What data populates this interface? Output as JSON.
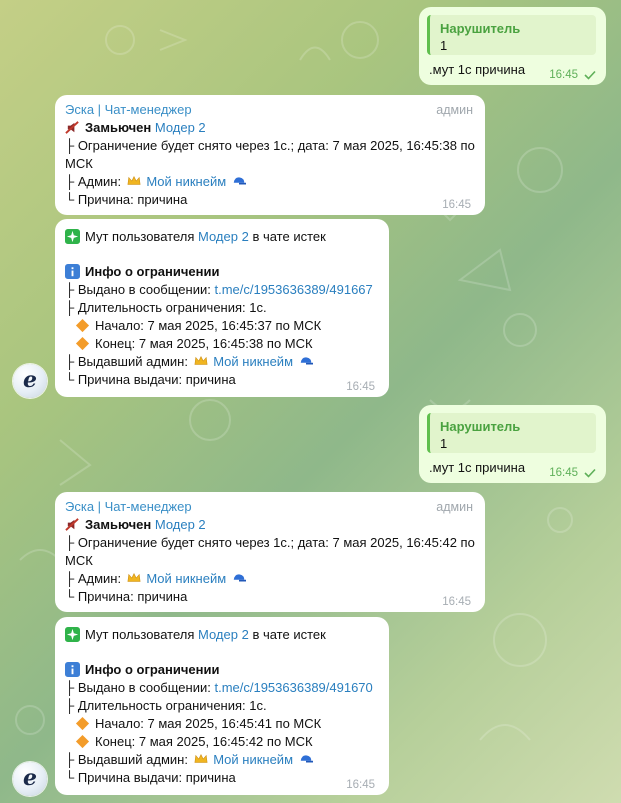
{
  "self": {
    "quote_name": "Нарушитель",
    "quote_text": "1",
    "text": ".мут 1с причина",
    "time": "16:45"
  },
  "bot": {
    "name": "Эска | Чат-менеджер",
    "role": "админ",
    "avatar_letter": "e",
    "muted_label": "Замьючен",
    "user": "Модер 2",
    "admin_nick": "Мой никнейм"
  },
  "mute_msgs": [
    {
      "line1": "├ Ограничение будет снято через 1с.; дата: 7 мая 2025, 16:45:38 по",
      "line2": "МСК",
      "admin_label": "├ Админ:",
      "reason": "└ Причина: причина",
      "time": "16:45"
    },
    {
      "line1": "├ Ограничение будет снято через 1с.; дата: 7 мая 2025, 16:45:42 по",
      "line2": "МСК",
      "admin_label": "├ Админ:",
      "reason": "└ Причина: причина",
      "time": "16:45"
    }
  ],
  "expire_msgs": [
    {
      "prefix": "Мут пользователя",
      "suffix": "в чате истек",
      "info_title": "Инфо о ограничении",
      "issued_label": "├ Выдано в сообщении:",
      "link": "t.me/c/1953636389/491667",
      "duration": "├ Длительность ограничения: 1с.",
      "start": "Начало: 7 мая 2025, 16:45:37 по МСК",
      "end": "Конец: 7 мая 2025, 16:45:38 по МСК",
      "issuer_label": "├ Выдавший админ:",
      "reason": "└ Причина выдачи: причина",
      "time": "16:45"
    },
    {
      "prefix": "Мут пользователя",
      "suffix": "в чате истек",
      "info_title": "Инфо о ограничении",
      "issued_label": "├ Выдано в сообщении:",
      "link": "t.me/c/1953636389/491670",
      "duration": "├ Длительность ограничения: 1с.",
      "start": "Начало: 7 мая 2025, 16:45:41 по МСК",
      "end": "Конец: 7 мая 2025, 16:45:42 по МСК",
      "issuer_label": "├ Выдавший админ:",
      "reason": "└ Причина выдачи: причина",
      "time": "16:45"
    }
  ],
  "icons": {
    "muted": "muted-speaker-icon",
    "crown": "crown-icon",
    "cap": "blue-cap-icon",
    "sparkle": "sparkle-icon",
    "info": "info-icon",
    "diamond": "orange-diamond-icon",
    "check": "check-icon"
  },
  "colors": {
    "outgoing_bubble": "#eefedf",
    "incoming_bubble": "#ffffff",
    "link": "#2a7fbf",
    "sender_name": "#3a8fc7",
    "quote_accent": "#5fbf4d"
  }
}
